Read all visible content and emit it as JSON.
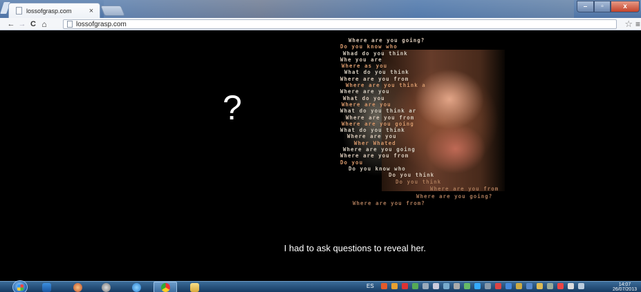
{
  "browser": {
    "tab_title": "lossofgrasp.com",
    "tab_close": "×",
    "url": "lossofgrasp.com",
    "back": "←",
    "forward": "→",
    "reload": "C",
    "home": "⌂",
    "star": "☆",
    "menu": "≡",
    "window_controls": {
      "minimize": "–",
      "maximize": "▫",
      "close": "x"
    }
  },
  "page": {
    "question_mark": "?",
    "caption": "I had to ask questions to reveal her.",
    "portrait_text": [
      "Where are you going?",
      "Do you know who",
      "Whad do you think",
      "Whe you are",
      "Where as you",
      "What do you think",
      "Where are you from",
      "Where are you think a",
      "Where are you",
      "What do you",
      "Where are you",
      "What do you think ar",
      "Where are you from",
      "Where are you going",
      "What do you think",
      "Where are you",
      "Wher Whated",
      "Where are you going",
      "Where are you from",
      "Do you",
      "Do you know who",
      "Do you think"
    ],
    "portrait_tail": [
      "Do you think",
      "Where are you from",
      "Where are you going?",
      "Where are you from?"
    ]
  },
  "taskbar": {
    "language": "ES",
    "time": "14:07",
    "date": "26/07/2013"
  },
  "colors": {
    "page_background": "#000000",
    "taskbar": "#173b63",
    "caption": "#ffffff"
  }
}
